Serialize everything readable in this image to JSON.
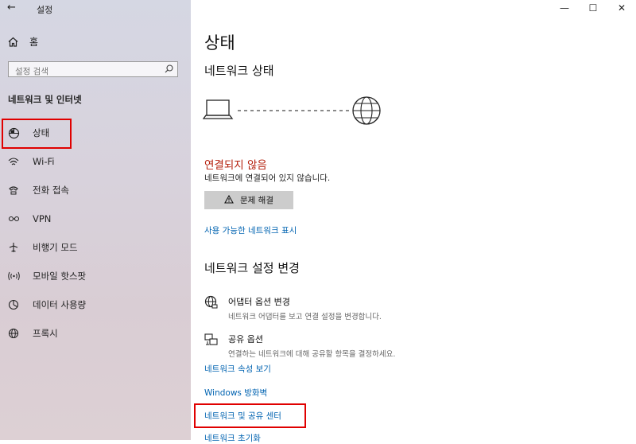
{
  "window": {
    "title": "설정",
    "controls": {
      "minimize": "—",
      "maximize": "☐",
      "close": "✕"
    }
  },
  "sidebar": {
    "home_label": "홈",
    "search_placeholder": "설정 검색",
    "section_title": "네트워크 및 인터넷",
    "items": [
      {
        "label": "상태",
        "icon": "status-icon"
      },
      {
        "label": "Wi-Fi",
        "icon": "wifi-icon"
      },
      {
        "label": "전화 접속",
        "icon": "dialup-icon"
      },
      {
        "label": "VPN",
        "icon": "vpn-icon"
      },
      {
        "label": "비행기 모드",
        "icon": "airplane-icon"
      },
      {
        "label": "모바일 핫스팟",
        "icon": "hotspot-icon"
      },
      {
        "label": "데이터 사용량",
        "icon": "data-usage-icon"
      },
      {
        "label": "프록시",
        "icon": "globe-icon"
      }
    ]
  },
  "main": {
    "page_title": "상태",
    "network_status_heading": "네트워크 상태",
    "status_text": "연결되지 않음",
    "status_detail": "네트워크에 연결되어 있지 않습니다.",
    "troubleshoot_label": "문제 해결",
    "show_available_link": "사용 가능한 네트워크 표시",
    "change_settings_heading": "네트워크 설정 변경",
    "options": [
      {
        "title": "어댑터 옵션 변경",
        "desc": "네트워크 어댑터를 보고 연결 설정을 변경합니다.",
        "icon": "adapter-globe-icon"
      },
      {
        "title": "공유 옵션",
        "desc": "연결하는 네트워크에 대해 공유할 항목을 결정하세요.",
        "icon": "sharing-icon"
      }
    ],
    "links": {
      "properties": "네트워크 속성 보기",
      "firewall": "Windows 방화벽",
      "sharing_center": "네트워크 및 공유 센터",
      "reset": "네트워크 초기화"
    }
  },
  "colors": {
    "link": "#0063b1",
    "error": "#b5200d",
    "highlight": "#e00000",
    "button_bg": "#cccccc"
  }
}
